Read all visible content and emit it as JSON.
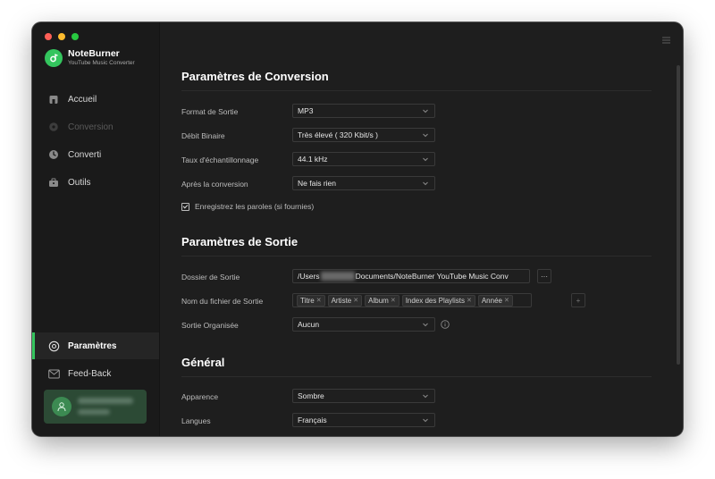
{
  "app": {
    "name": "NoteBurner",
    "subtitle": "YouTube Music Converter"
  },
  "sidebar": {
    "items": [
      {
        "label": "Accueil",
        "icon": "home-icon",
        "state": "normal"
      },
      {
        "label": "Conversion",
        "icon": "conversion-icon",
        "state": "disabled"
      },
      {
        "label": "Converti",
        "icon": "clock-icon",
        "state": "normal"
      },
      {
        "label": "Outils",
        "icon": "toolbox-icon",
        "state": "normal"
      },
      {
        "label": "Paramètres",
        "icon": "settings-icon",
        "state": "active"
      },
      {
        "label": "Feed-Back",
        "icon": "mail-icon",
        "state": "normal"
      }
    ]
  },
  "conversion": {
    "title": "Paramètres de Conversion",
    "format_label": "Format de Sortie",
    "format_value": "MP3",
    "bitrate_label": "Débit Binaire",
    "bitrate_value": "Très élevé ( 320 Kbit/s )",
    "samplerate_label": "Taux d'échantillonnage",
    "samplerate_value": "44.1 kHz",
    "after_label": "Après la conversion",
    "after_value": "Ne fais rien",
    "lyrics_label": "Enregistrez les paroles (si fournies)",
    "lyrics_checked": true
  },
  "output": {
    "title": "Paramètres de Sortie",
    "folder_label": "Dossier de Sortie",
    "folder_prefix": "/Users",
    "folder_suffix": "Documents/NoteBurner YouTube Music Conv",
    "browse_label": "···",
    "filename_label": "Nom du fichier de Sortie",
    "filename_tags": [
      "Titre",
      "Artiste",
      "Album",
      "Index des Playlists",
      "Année"
    ],
    "add_label": "+",
    "organized_label": "Sortie Organisée",
    "organized_value": "Aucun"
  },
  "general": {
    "title": "Général",
    "appearance_label": "Apparence",
    "appearance_value": "Sombre",
    "language_label": "Langues",
    "language_value": "Français"
  },
  "colors": {
    "accent": "#34c55e",
    "background": "#1e1e1e",
    "sidebar": "#1a1a1a"
  }
}
